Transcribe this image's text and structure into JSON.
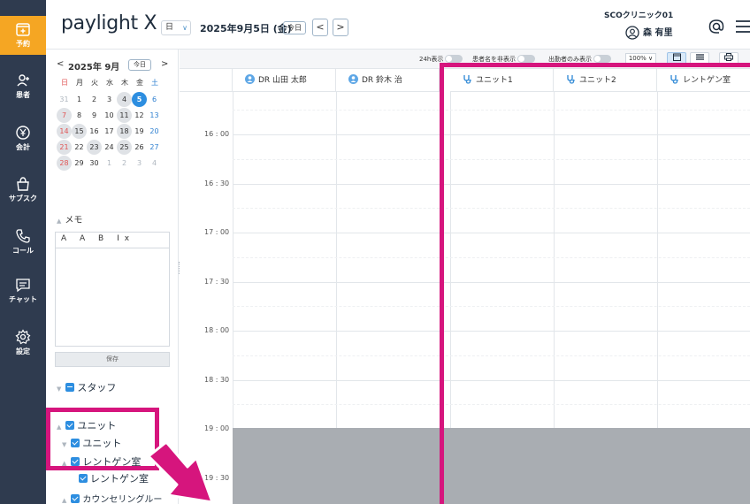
{
  "nav": [
    {
      "label": "予約",
      "icon": "calendar-plus-icon"
    },
    {
      "label": "患者",
      "icon": "person-add-icon"
    },
    {
      "label": "会計",
      "icon": "yen-icon"
    },
    {
      "label": "サブスク",
      "icon": "bag-plus-icon"
    },
    {
      "label": "コール",
      "icon": "phone-icon"
    },
    {
      "label": "チャット",
      "icon": "chat-icon"
    },
    {
      "label": "設定",
      "icon": "gear-icon"
    }
  ],
  "header": {
    "logo": "paylight X",
    "view": "日",
    "date": "2025年9月5日 (金)",
    "today": "今日",
    "prev": "<",
    "next": ">",
    "clinic": "SCOクリニック01",
    "user": "森 有里"
  },
  "calendar": {
    "month": "2025年 9月",
    "today": "今日",
    "prev": "<",
    "next": ">",
    "weekdays": [
      "日",
      "月",
      "火",
      "水",
      "木",
      "金",
      "土"
    ],
    "weeks": [
      [
        "31",
        "1",
        "2",
        "3",
        "4",
        "5",
        "6"
      ],
      [
        "7",
        "8",
        "9",
        "10",
        "11",
        "12",
        "13"
      ],
      [
        "14",
        "15",
        "16",
        "17",
        "18",
        "19",
        "20"
      ],
      [
        "21",
        "22",
        "23",
        "24",
        "25",
        "26",
        "27"
      ],
      [
        "28",
        "29",
        "30",
        "1",
        "2",
        "3",
        "4"
      ]
    ],
    "selected": "5"
  },
  "memo": {
    "title": "メモ",
    "toolbar": "A A B Ix",
    "save": "保存"
  },
  "tree": {
    "staff": "スタッフ",
    "unit_group": "ユニット",
    "unit": "ユニット",
    "xray_group": "レントゲン室",
    "xray": "レントゲン室",
    "counseling": "カウンセリングルー"
  },
  "toolbar": {
    "show24": "24h表示",
    "hide_patient": "患者名を非表示",
    "attending_only": "出勤者のみ表示",
    "zoom": "100%"
  },
  "columns": [
    "DR 山田 太郎",
    "DR 鈴木 治",
    "ユニット1",
    "ユニット2",
    "レントゲン室"
  ],
  "times": [
    "16 : 00",
    "16 : 30",
    "17 : 00",
    "17 : 30",
    "18 : 00",
    "18 : 30",
    "19 : 00",
    "19 : 30"
  ],
  "colors": {
    "nav_bg": "#2f3b4f",
    "active": "#f5a623",
    "accent": "#2d8ee0",
    "highlight": "#d6157d",
    "closed": "#a9adb2"
  }
}
